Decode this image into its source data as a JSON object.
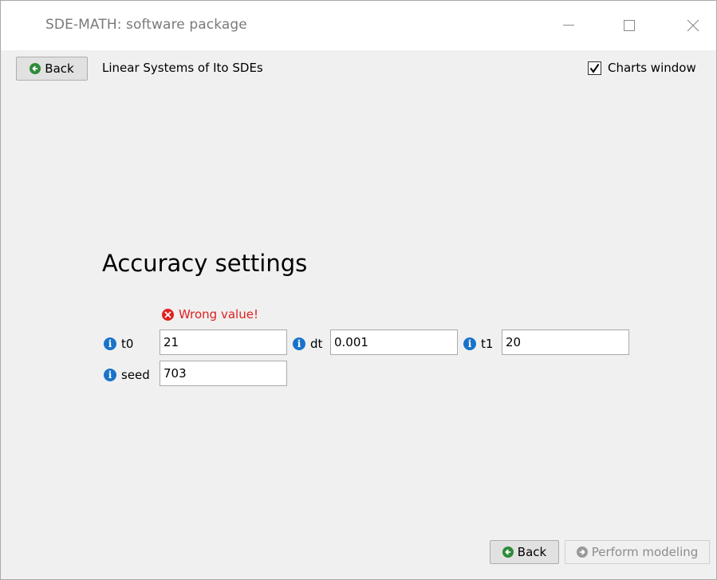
{
  "window": {
    "title": "SDE-MATH: software package"
  },
  "header": {
    "back_label": "Back",
    "page_heading": "Linear Systems of Ito SDEs",
    "charts_window_label": "Charts window",
    "charts_window_checked": true
  },
  "accuracy": {
    "title": "Accuracy settings",
    "error_message": "Wrong value!",
    "fields": {
      "t0": {
        "label": "t0",
        "value": "21"
      },
      "dt": {
        "label": "dt",
        "value": "0.001"
      },
      "t1": {
        "label": "t1",
        "value": "20"
      },
      "seed": {
        "label": "seed",
        "value": "703"
      }
    }
  },
  "footer": {
    "back_label": "Back",
    "perform_label": "Perform modeling",
    "perform_enabled": false
  },
  "colors": {
    "info_blue": "#1a73c9",
    "error_red": "#e02020",
    "back_green": "#2e8b3a",
    "disabled_gray": "#8c8c8c"
  },
  "icons": {
    "back": "green-circle-left-arrow",
    "perform": "gray-circle-right-arrow",
    "info": "info-circle",
    "error": "red-circle-x",
    "check": "checkmark"
  }
}
